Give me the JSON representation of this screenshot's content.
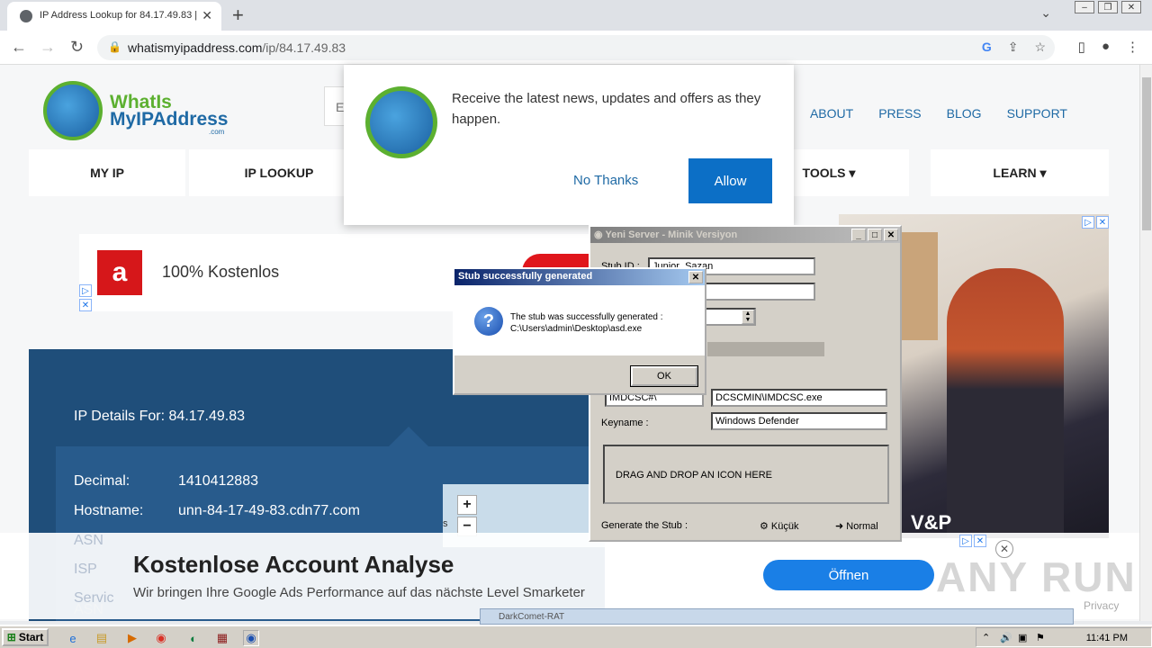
{
  "browser": {
    "tab_title": "IP Address Lookup for 84.17.49.83 |",
    "url_host": "whatismyipaddress.com",
    "url_path": "/ip/84.17.49.83"
  },
  "site": {
    "logo_line1": "WhatIs",
    "logo_line2": "MyIPAddress",
    "logo_dot": ".com",
    "search_stub": "E",
    "top_nav": [
      "ABOUT",
      "PRESS",
      "BLOG",
      "SUPPORT"
    ],
    "main_nav": [
      "MY IP",
      "IP LOOKUP",
      "TOOLS ▾",
      "LEARN ▾"
    ]
  },
  "notification": {
    "message": "Receive the latest news, updates and offers as they happen.",
    "no_thanks": "No Thanks",
    "allow": "Allow"
  },
  "ad_top": {
    "text": "100% Kostenlos",
    "logo": "a"
  },
  "ad_right": {
    "text": "V&P"
  },
  "ip_details": {
    "heading": "IP Details For: 84.17.49.83",
    "rows": [
      {
        "key": "Decimal:",
        "value": "1410412883"
      },
      {
        "key": "Hostname:",
        "value": "unn-84-17-49-83.cdn77.com"
      }
    ],
    "faded": [
      "ASN",
      "ISP",
      "Servic"
    ],
    "zoom_in": "+",
    "zoom_out": "−",
    "map_letter": "s"
  },
  "bottom_ad": {
    "headline": "Kostenlose Account Analyse",
    "subline": "Wir bringen Ihre Google Ads Performance auf das nächste Level Smarketer",
    "button": "Öffnen",
    "watermark": "ANY RUN",
    "privacy": "Privacy"
  },
  "yeni_server": {
    "title": "Yeni Server - Minik Versiyon",
    "stub_id_label": "Stub ID :",
    "stub_id_value": "Junior_Sazan",
    "install_value": "IMDCSC#\\",
    "exe_value": "DCSCMIN\\IMDCSC.exe",
    "keyname_label": "Keyname :",
    "keyname_value": "Windows Defender",
    "drop_text": "DRAG AND DROP AN ICON HERE",
    "generate_label": "Generate the Stub :",
    "kucuk": "Küçük",
    "normal": "Normal"
  },
  "stub_dialog": {
    "title": "Stub successfully generated",
    "line1": "The stub was successfully generated :",
    "line2": "C:\\Users\\admin\\Desktop\\asd.exe",
    "ok": "OK"
  },
  "taskbar": {
    "start": "Start",
    "clock": "11:41 PM",
    "dc_label": "DarkComet-RAT"
  }
}
